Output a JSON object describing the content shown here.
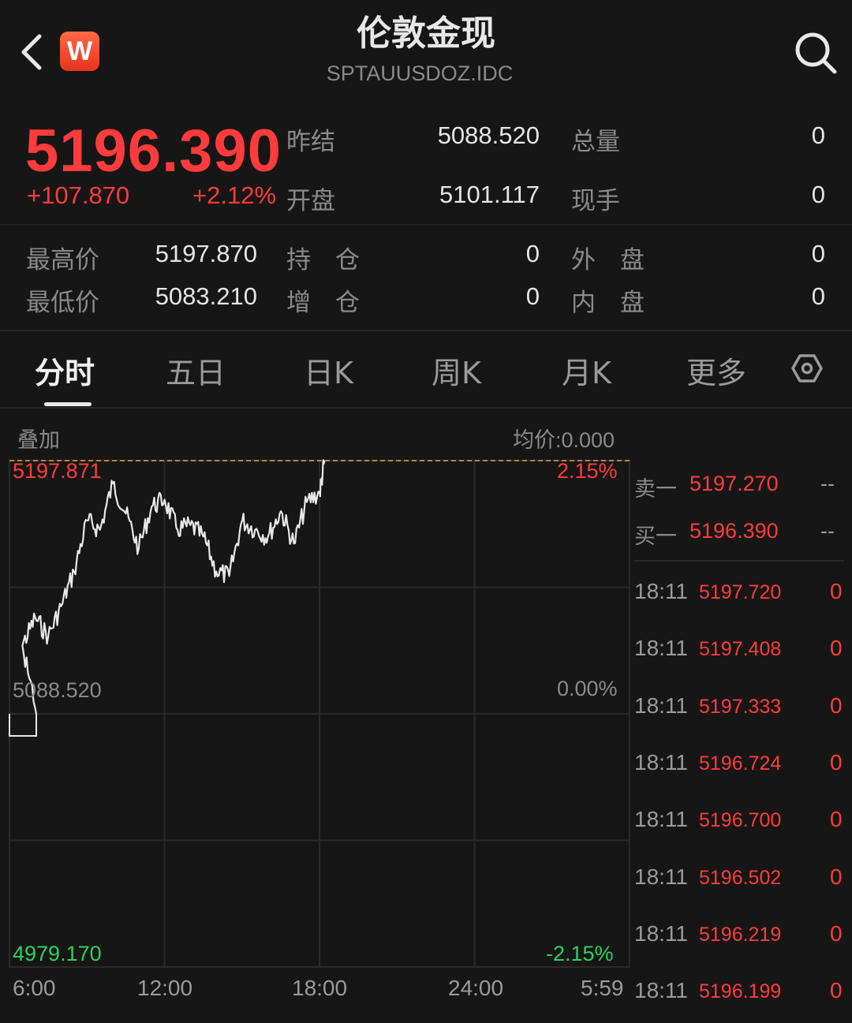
{
  "header": {
    "title": "伦敦金现",
    "code": "SPTAUUSDOZ.IDC",
    "logo_letter": "W",
    "icons": [
      "back-icon",
      "search-icon"
    ]
  },
  "quote": {
    "price": "5196.390",
    "change": "+107.870",
    "change_pct": "+2.12%",
    "prev_close_label": "昨结",
    "prev_close": "5088.520",
    "open_label": "开盘",
    "open": "5101.117",
    "total_vol_label": "总量",
    "total_vol": "0",
    "cur_hand_label": "现手",
    "cur_hand": "0",
    "high_label": "最高价",
    "high": "5197.870",
    "low_label": "最低价",
    "low": "5083.210",
    "hold_label": "持　仓",
    "hold": "0",
    "add_label": "增　仓",
    "add": "0",
    "outer_label": "外　盘",
    "outer": "0",
    "inner_label": "内　盘",
    "inner": "0"
  },
  "tabs": [
    {
      "label": "分时",
      "active": true
    },
    {
      "label": "五日",
      "active": false
    },
    {
      "label": "日K",
      "active": false
    },
    {
      "label": "周K",
      "active": false
    },
    {
      "label": "月K",
      "active": false
    },
    {
      "label": "更多",
      "active": false
    }
  ],
  "chart_header": {
    "overlay": "叠加",
    "avg_price": "均价:0.000"
  },
  "chart_data": {
    "type": "line",
    "title": "",
    "y_labels": {
      "top": "5197.871",
      "mid": "5088.520",
      "bottom": "4979.170",
      "top_pct": "2.15%",
      "mid_pct": "0.00%",
      "bottom_pct": "-2.15%"
    },
    "x_ticks": [
      "6:00",
      "12:00",
      "18:00",
      "24:00",
      "5:59"
    ],
    "ylim": [
      4979.17,
      5197.871
    ],
    "reference_line": 5088.52,
    "series": [
      {
        "x": [
          "6:00",
          "6:30",
          "7:00",
          "7:30",
          "8:00",
          "8:30",
          "9:00",
          "9:30",
          "10:00",
          "10:30",
          "11:00",
          "11:30",
          "12:00",
          "12:30",
          "13:00",
          "13:30",
          "14:00",
          "14:30",
          "15:00",
          "15:30",
          "16:00",
          "16:30",
          "17:00",
          "17:30",
          "18:00",
          "18:11"
        ],
        "values": [
          5088.5,
          5118,
          5130,
          5122,
          5135,
          5150,
          5172,
          5168,
          5188,
          5175,
          5160,
          5178,
          5181,
          5168,
          5170,
          5165,
          5150,
          5148,
          5172,
          5168,
          5165,
          5176,
          5162,
          5180,
          5184,
          5197.9
        ]
      }
    ]
  },
  "order_book": {
    "sell1_label": "卖一",
    "sell1_price": "5197.270",
    "sell1_vol": "--",
    "buy1_label": "买一",
    "buy1_price": "5196.390",
    "buy1_vol": "--"
  },
  "trades": [
    {
      "time": "18:11",
      "price": "5197.720",
      "vol": "0"
    },
    {
      "time": "18:11",
      "price": "5197.408",
      "vol": "0"
    },
    {
      "time": "18:11",
      "price": "5197.333",
      "vol": "0"
    },
    {
      "time": "18:11",
      "price": "5196.724",
      "vol": "0"
    },
    {
      "time": "18:11",
      "price": "5196.700",
      "vol": "0"
    },
    {
      "time": "18:11",
      "price": "5196.502",
      "vol": "0"
    },
    {
      "time": "18:11",
      "price": "5196.219",
      "vol": "0"
    },
    {
      "time": "18:11",
      "price": "5196.199",
      "vol": "0"
    }
  ],
  "colors": {
    "up": "#ff3b3b",
    "down": "#2bd15f",
    "line": "#e8e8e8",
    "bg": "#161616"
  }
}
